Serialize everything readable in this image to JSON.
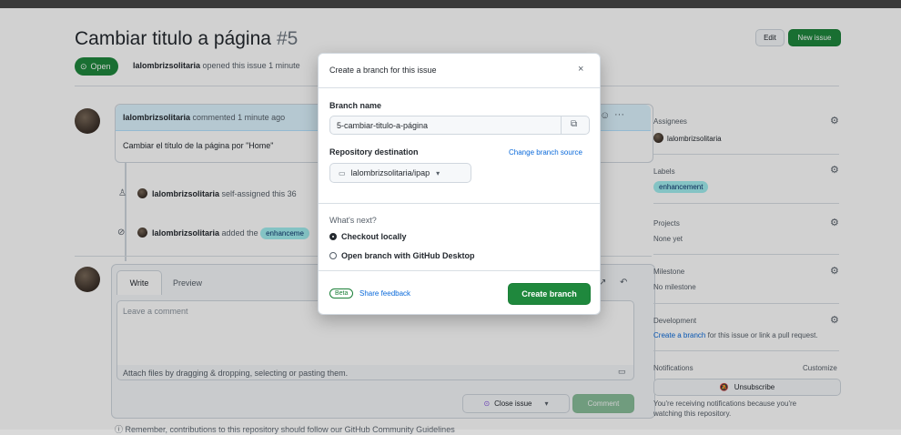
{
  "issue": {
    "title": "Cambiar titulo a página",
    "number": "#5",
    "state": "Open",
    "author": "lalombrizsolitaria",
    "meta_text": "opened this issue 1 minute",
    "edit_label": "Edit",
    "new_issue_label": "New issue"
  },
  "comment": {
    "author": "lalombrizsolitaria",
    "time": "commented 1 minute ago",
    "body": "Cambiar el título de la página por \"Home\""
  },
  "timeline": {
    "event1_author": "lalombrizsolitaria",
    "event1_text": "self-assigned this 36",
    "event2_author": "lalombrizsolitaria",
    "event2_text": "added the",
    "event2_label": "enhanceme"
  },
  "composer": {
    "tab_write": "Write",
    "tab_preview": "Preview",
    "placeholder": "Leave a comment",
    "attach_text": "Attach files by dragging & dropping, selecting or pasting them.",
    "close_issue_label": "Close issue",
    "comment_label": "Comment",
    "footer_text": "Remember, contributions to this repository should follow our GitHub Community Guidelines"
  },
  "sidebar": {
    "assignees_title": "Assignees",
    "assignee": "lalombrizsolitaria",
    "labels_title": "Labels",
    "label": "enhancement",
    "projects_title": "Projects",
    "projects_value": "None yet",
    "milestone_title": "Milestone",
    "milestone_value": "No milestone",
    "development_title": "Development",
    "development_link": "Create a branch",
    "development_text": "for this issue or link a pull request.",
    "notifications_title": "Notifications",
    "customize": "Customize",
    "unsubscribe": "Unsubscribe",
    "notif_text_1": "You're receiving notifications because you're",
    "notif_text_2": "watching this repository."
  },
  "modal": {
    "title": "Create a branch for this issue",
    "branch_name_label": "Branch name",
    "branch_name_value": "5-cambiar-titulo-a-página",
    "repo_dest_label": "Repository destination",
    "change_source": "Change branch source",
    "repo_value": "lalombrizsolitaria/ipap",
    "whats_next": "What's next?",
    "option_checkout": "Checkout locally",
    "option_desktop": "Open branch with GitHub Desktop",
    "beta": "Beta",
    "share_feedback": "Share feedback",
    "create_branch": "Create branch"
  }
}
